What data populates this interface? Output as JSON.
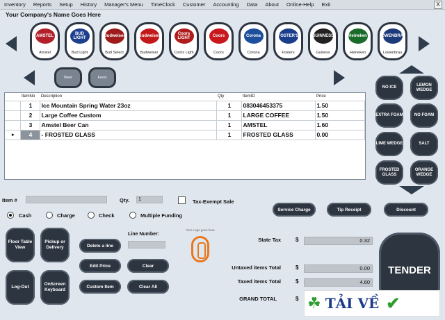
{
  "menu": [
    "Inventory",
    "Reports",
    "Setup",
    "History",
    "Manager's Menu",
    "TimeClock",
    "Customer",
    "Accounting",
    "Data",
    "About",
    "Online-Help",
    "Exit"
  ],
  "close_label": "X",
  "company": "Your Company's Name Goes Here",
  "beers": [
    {
      "label": "Amstel",
      "logo": "AMSTEL",
      "color": "#b2202a"
    },
    {
      "label": "Bud Light",
      "logo": "BUD LIGHT",
      "color": "#1e3f8f"
    },
    {
      "label": "Bud Select",
      "logo": "Budweiser",
      "color": "#9d1b1b"
    },
    {
      "label": "Budweiser",
      "logo": "Budweiser",
      "color": "#c21a1a"
    },
    {
      "label": "Coors Light",
      "logo": "Coors LIGHT",
      "color": "#b01c1c"
    },
    {
      "label": "Coors",
      "logo": "Coors",
      "color": "#c8171d"
    },
    {
      "label": "Corona",
      "logo": "Corona",
      "color": "#1e4f9c"
    },
    {
      "label": "Fosters",
      "logo": "FOSTER'S",
      "color": "#1a3e8a"
    },
    {
      "label": "Guiness",
      "logo": "GUINNESS",
      "color": "#222222"
    },
    {
      "label": "Heineken",
      "logo": "Heineken",
      "color": "#1b6b2b"
    },
    {
      "label": "Lowenbrau",
      "logo": "LÖWENBRÄU",
      "color": "#1d3b7a"
    }
  ],
  "categories": [
    "Beer",
    "Food"
  ],
  "modifiers": [
    {
      "label": "NO ICE"
    },
    {
      "label": "LEMON WEDGE"
    },
    {
      "label": "EXTRA FOAM"
    },
    {
      "label": "NO FOAM"
    },
    {
      "label": "LIME WEDGE"
    },
    {
      "label": "SALT"
    },
    {
      "label": "FROSTED GLASS"
    },
    {
      "label": "ORANGE WEDGE"
    }
  ],
  "grid": {
    "headers": [
      "ItemNo",
      "Description",
      "Qty",
      "ItemID",
      "Price"
    ],
    "rows": [
      {
        "no": "1",
        "desc": "Ice Mountain Spring Water 23oz",
        "qty": "1",
        "id": "083046453375",
        "price": "1.50"
      },
      {
        "no": "2",
        "desc": "Large Coffee Custom",
        "qty": "1",
        "id": "LARGE COFFEE",
        "price": "1.50"
      },
      {
        "no": "3",
        "desc": "Amstel Beer Can",
        "qty": "1",
        "id": "AMSTEL",
        "price": "1.60"
      },
      {
        "no": "4",
        "desc": "- FROSTED GLASS",
        "qty": "1",
        "id": "FROSTED GLASS",
        "price": "0.00"
      }
    ]
  },
  "item_label": "Item #",
  "item_value": "",
  "qty_label": "Qty.",
  "qty_value": "1",
  "tax_exempt_label": "Tax-Exempt Sale",
  "payment": [
    "Cash",
    "Charge",
    "Check",
    "Multiple Funding"
  ],
  "actions": {
    "service_charge": "Service Charge",
    "tip_receipt": "Tip Receipt",
    "discount": "Discount"
  },
  "big_buttons": [
    "Floor Table View",
    "Pickup or Delivery",
    "Log-Out",
    "OnScreen Keyboard"
  ],
  "mid_buttons": [
    "Delete a line",
    "Edit Price",
    "Clear",
    "Custom Item",
    "Clear All"
  ],
  "line_number_label": "Line Number:",
  "logo_text": "Your Logo goes here",
  "totals": [
    {
      "label": "State Tax",
      "value": "0.32"
    },
    {
      "label": "Untaxed items Total",
      "value": "0.00"
    },
    {
      "label": "Taxed items Total",
      "value": "4.60"
    },
    {
      "label": "GRAND TOTAL",
      "value": ""
    }
  ],
  "currency": "$",
  "tender": "TENDER",
  "watermark": {
    "text": "TẢI VỀ",
    "clover": "☘",
    "check": "✔"
  }
}
